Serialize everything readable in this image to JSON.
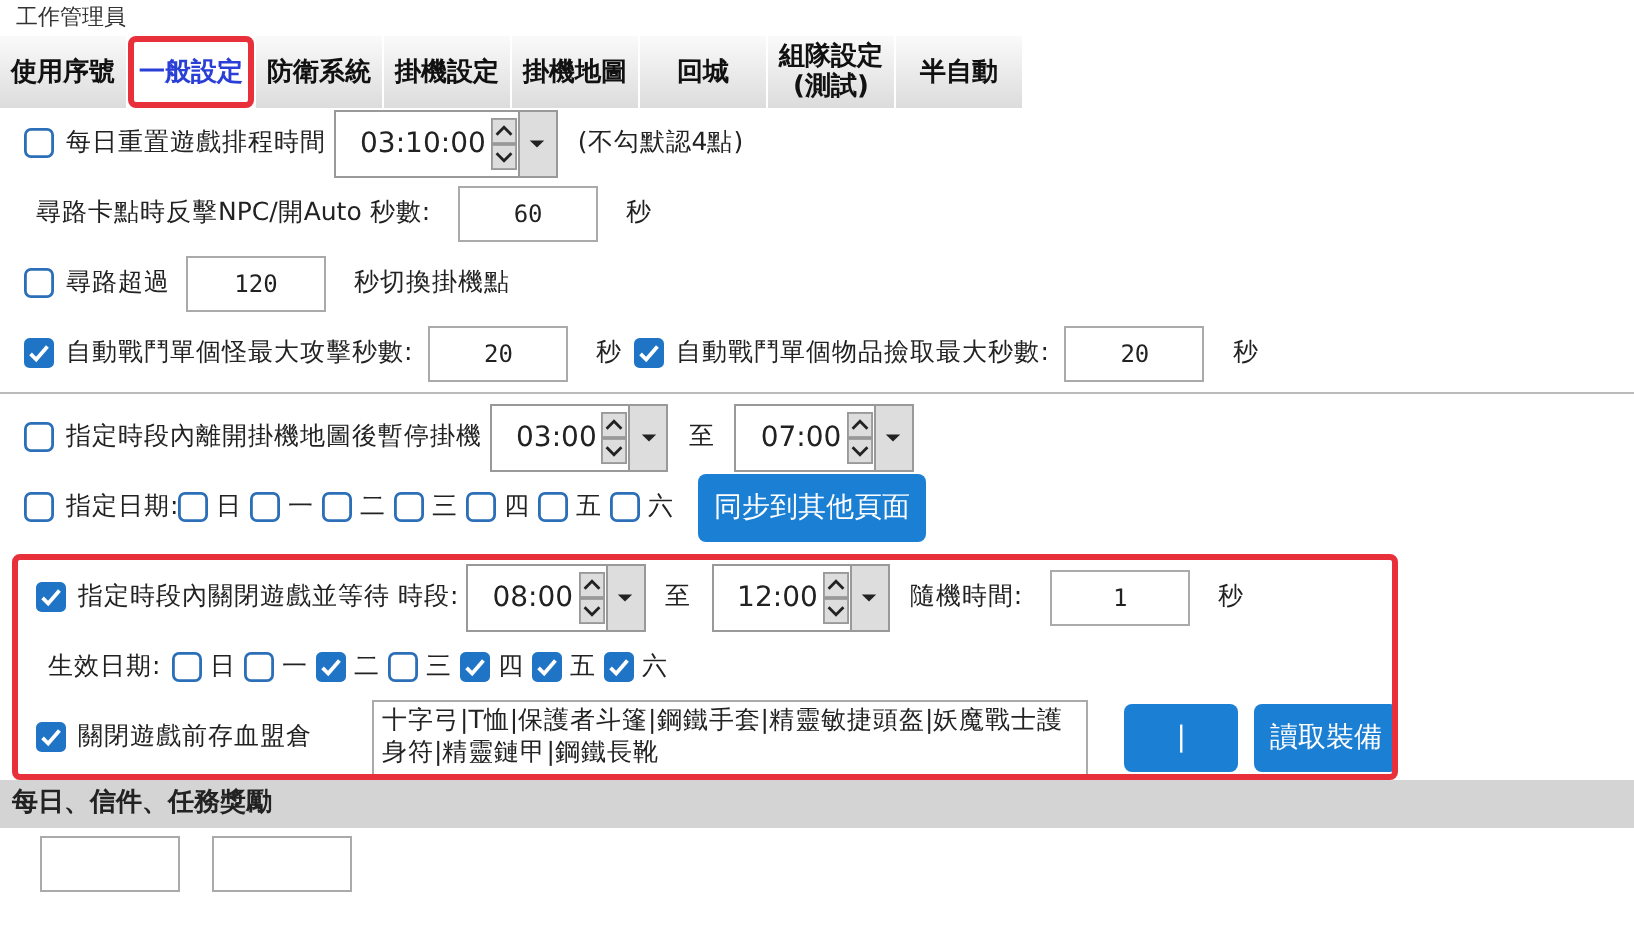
{
  "window": {
    "title": "工作管理員"
  },
  "tabs": [
    {
      "label": "使用序號",
      "selected": false,
      "highlighted": false
    },
    {
      "label": "一般設定",
      "selected": true,
      "highlighted": true
    },
    {
      "label": "防衛系統",
      "selected": false,
      "highlighted": false
    },
    {
      "label": "掛機設定",
      "selected": false,
      "highlighted": false
    },
    {
      "label": "掛機地圖",
      "selected": false,
      "highlighted": false
    },
    {
      "label": "回城",
      "selected": false,
      "highlighted": false
    },
    {
      "label": "組隊設定\n(測試)",
      "selected": false,
      "highlighted": false
    },
    {
      "label": "半自動",
      "selected": false,
      "highlighted": false
    }
  ],
  "rows": [
    {
      "kind": "row",
      "items": [
        {
          "kind": "check",
          "checked": false,
          "label": "每日重置遊戲排程時間"
        },
        {
          "kind": "time",
          "value": "03:10:00"
        },
        {
          "kind": "text",
          "text": "(不勾默認4點)"
        }
      ]
    },
    {
      "kind": "row",
      "items": [
        {
          "kind": "text",
          "text": "尋路卡點時反擊NPC/開Auto 秒數:"
        },
        {
          "kind": "field",
          "value": "60"
        },
        {
          "kind": "text",
          "text": "秒"
        }
      ]
    },
    {
      "kind": "row",
      "items": [
        {
          "kind": "check",
          "checked": false,
          "label": "尋路超過"
        },
        {
          "kind": "field",
          "value": "120"
        },
        {
          "kind": "text",
          "text": "秒切換掛機點"
        }
      ]
    },
    {
      "kind": "row",
      "items": [
        {
          "kind": "check",
          "checked": true,
          "label": "自動戰鬥單個怪最大攻擊秒數:"
        },
        {
          "kind": "field",
          "value": "20"
        },
        {
          "kind": "text",
          "text": "秒"
        },
        {
          "kind": "check",
          "checked": true,
          "label": "自動戰鬥單個物品撿取最大秒數:"
        },
        {
          "kind": "field",
          "value": "20"
        },
        {
          "kind": "text",
          "text": "秒"
        }
      ]
    },
    {
      "kind": "rule"
    },
    {
      "kind": "row",
      "items": [
        {
          "kind": "check",
          "checked": false,
          "label": "指定時段內離開掛機地圖後暫停掛機"
        },
        {
          "kind": "time",
          "value": "03:00"
        },
        {
          "kind": "text",
          "text": "至"
        },
        {
          "kind": "time",
          "value": "07:00"
        }
      ]
    },
    {
      "kind": "row",
      "items": [
        {
          "kind": "check",
          "checked": false,
          "label": "指定日期:"
        },
        {
          "kind": "day",
          "checked": false,
          "label": "日"
        },
        {
          "kind": "day",
          "checked": false,
          "label": "一"
        },
        {
          "kind": "day",
          "checked": false,
          "label": "二"
        },
        {
          "kind": "day",
          "checked": false,
          "label": "三"
        },
        {
          "kind": "day",
          "checked": false,
          "label": "四"
        },
        {
          "kind": "day",
          "checked": false,
          "label": "五"
        },
        {
          "kind": "day",
          "checked": false,
          "label": "六"
        },
        {
          "kind": "button",
          "label": "同步到其他頁面"
        }
      ]
    },
    {
      "kind": "group",
      "highlighted": true,
      "rows": [
        {
          "kind": "row",
          "items": [
            {
              "kind": "check",
              "checked": true,
              "label": "指定時段內關閉遊戲並等待 時段:"
            },
            {
              "kind": "time",
              "value": "08:00"
            },
            {
              "kind": "text",
              "text": "至"
            },
            {
              "kind": "time",
              "value": "12:00"
            },
            {
              "kind": "text",
              "text": "隨機時間:"
            },
            {
              "kind": "field",
              "value": "1"
            },
            {
              "kind": "text",
              "text": "秒"
            }
          ]
        },
        {
          "kind": "row",
          "items": [
            {
              "kind": "text",
              "text": "生效日期:"
            },
            {
              "kind": "day",
              "checked": false,
              "label": "日"
            },
            {
              "kind": "day",
              "checked": false,
              "label": "一"
            },
            {
              "kind": "day",
              "checked": true,
              "label": "二"
            },
            {
              "kind": "day",
              "checked": false,
              "label": "三"
            },
            {
              "kind": "day",
              "checked": true,
              "label": "四"
            },
            {
              "kind": "day",
              "checked": true,
              "label": "五"
            },
            {
              "kind": "day",
              "checked": true,
              "label": "六"
            }
          ]
        },
        {
          "kind": "row",
          "items": [
            {
              "kind": "check",
              "checked": true,
              "label": "關閉遊戲前存血盟倉"
            },
            {
              "kind": "memo",
              "value": "十字弓|T恤|保護者斗篷|鋼鐵手套|精靈敏捷頭盔|妖魔戰士護身符|精靈鏈甲|鋼鐵長靴"
            },
            {
              "kind": "button",
              "label": "|"
            },
            {
              "kind": "button",
              "label": "讀取裝備"
            }
          ]
        }
      ]
    },
    {
      "kind": "header",
      "text": "每日、信件、任務獎勵"
    },
    {
      "kind": "row",
      "items": [
        {
          "kind": "field",
          "value": ""
        },
        {
          "kind": "field",
          "value": ""
        }
      ]
    }
  ]
}
